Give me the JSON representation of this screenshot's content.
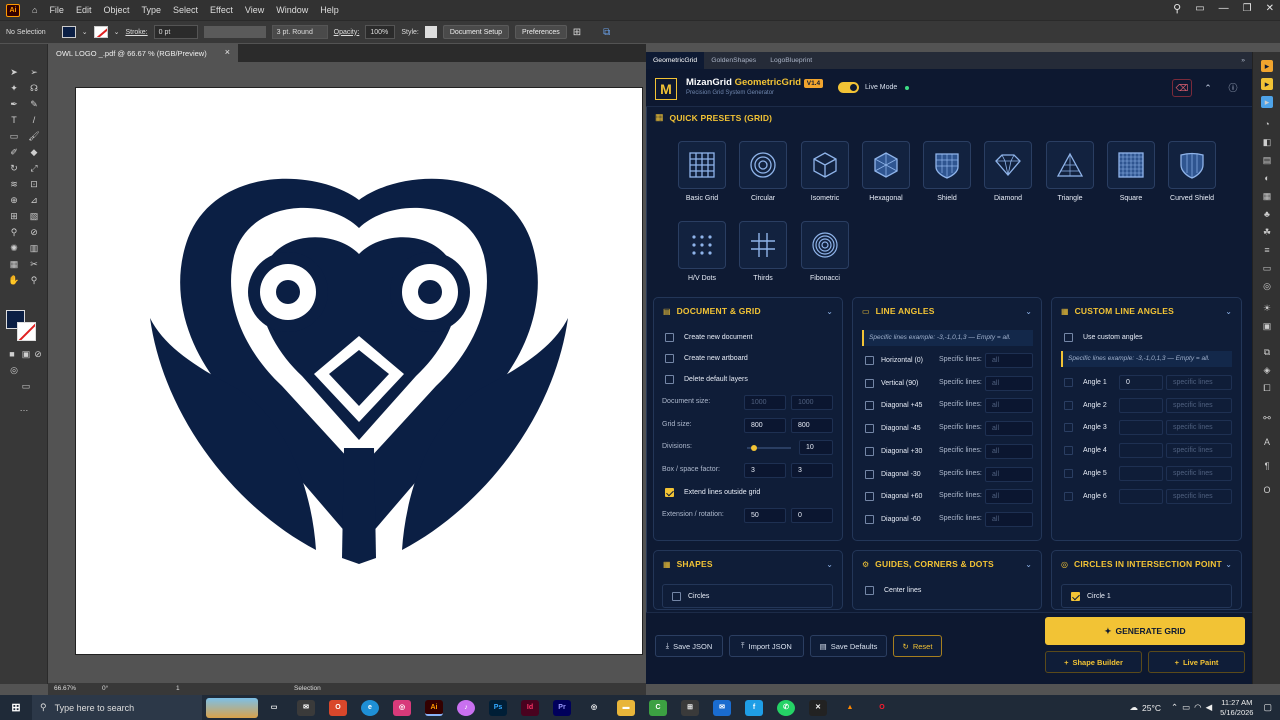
{
  "menubar": {
    "app_badge": "Ai",
    "items": [
      "File",
      "Edit",
      "Object",
      "Type",
      "Select",
      "Effect",
      "View",
      "Window",
      "Help"
    ]
  },
  "control_bar": {
    "selection_label": "No Selection",
    "stroke_label": "Stroke:",
    "stroke_value": "0 pt",
    "brush_value": "3 pt. Round",
    "opacity_label": "Opacity:",
    "opacity_value": "100%",
    "style_label": "Style:",
    "document_setup": "Document Setup",
    "preferences": "Preferences"
  },
  "document_tab": {
    "title": "OWL LOGO _.pdf @ 66.67 % (RGB/Preview)",
    "close": "×"
  },
  "status_bar": {
    "zoom": "66.67%",
    "rotation": "0°",
    "artboard": "1",
    "tool": "Selection"
  },
  "panel_tabs": [
    "GeometricGrid",
    "GoldenShapes",
    "LogoBlueprint"
  ],
  "panel_header": {
    "brand_a": "MizanGrid",
    "brand_b": "GeometricGrid",
    "version": "V1.4",
    "subtitle": "Precision Grid System Generator",
    "live_mode": "Live Mode"
  },
  "presets": {
    "title": "QUICK PRESETS (GRID)",
    "items": [
      {
        "label": "Basic Grid",
        "icon": "basic-grid-icon"
      },
      {
        "label": "Circular",
        "icon": "circular-icon"
      },
      {
        "label": "Isometric",
        "icon": "isometric-icon"
      },
      {
        "label": "Hexagonal",
        "icon": "hexagonal-icon"
      },
      {
        "label": "Shield",
        "icon": "shield-icon"
      },
      {
        "label": "Diamond",
        "icon": "diamond-icon"
      },
      {
        "label": "Triangle",
        "icon": "triangle-icon"
      },
      {
        "label": "Square",
        "icon": "square-icon"
      },
      {
        "label": "Curved Shield",
        "icon": "curved-shield-icon"
      },
      {
        "label": "H/V Dots",
        "icon": "dots-icon"
      },
      {
        "label": "Thirds",
        "icon": "thirds-icon"
      },
      {
        "label": "Fibonacci",
        "icon": "fibonacci-icon"
      }
    ]
  },
  "document_grid": {
    "title": "DOCUMENT & GRID",
    "create_doc": "Create new document",
    "create_artboard": "Create new artboard",
    "delete_layers": "Delete default layers",
    "doc_size_label": "Document size:",
    "doc_w": "1000",
    "doc_h": "1000",
    "grid_size_label": "Grid size:",
    "grid_w": "800",
    "grid_h": "800",
    "divisions_label": "Divisions:",
    "divisions": "10",
    "box_label": "Box / space factor:",
    "box_a": "3",
    "box_b": "3",
    "extend_label": "Extend lines outside grid",
    "ext_label": "Extension / rotation:",
    "ext_a": "50",
    "ext_b": "0"
  },
  "line_angles": {
    "title": "LINE ANGLES",
    "hint": "Specific lines example: -3,-1,0,1,3 — Empty = all.",
    "specific": "Specific lines:",
    "placeholder": "all",
    "rows": [
      "Horizontal (0)",
      "Vertical (90)",
      "Diagonal +45",
      "Diagonal -45",
      "Diagonal +30",
      "Diagonal -30",
      "Diagonal +60",
      "Diagonal -60"
    ]
  },
  "custom_angles": {
    "title": "CUSTOM LINE ANGLES",
    "use_custom": "Use custom angles",
    "hint": "Specific lines example: -3,-1,0,1,3 — Empty = all.",
    "placeholder": "specific lines",
    "rows": [
      {
        "label": "Angle 1",
        "value": "0"
      },
      {
        "label": "Angle 2",
        "value": ""
      },
      {
        "label": "Angle 3",
        "value": ""
      },
      {
        "label": "Angle 4",
        "value": ""
      },
      {
        "label": "Angle 5",
        "value": ""
      },
      {
        "label": "Angle 6",
        "value": ""
      }
    ]
  },
  "shapes": {
    "title": "SHAPES",
    "circles": "Circles"
  },
  "guides": {
    "title": "GUIDES, CORNERS & DOTS",
    "center_lines": "Center lines"
  },
  "circles_int": {
    "title": "CIRCLES IN INTERSECTION POINT",
    "circle1": "Circle 1"
  },
  "footer": {
    "save_json": "Save JSON",
    "import_json": "Import JSON",
    "save_defaults": "Save Defaults",
    "reset": "Reset",
    "generate": "GENERATE GRID",
    "shape_builder": "Shape Builder",
    "live_paint": "Live Paint"
  },
  "taskbar": {
    "search_placeholder": "Type here to search",
    "weather": "25°C",
    "time": "11:27 AM",
    "date": "5/16/2026"
  },
  "colors": {
    "logo": "#0b1f44",
    "accent": "#f2c335",
    "panel_bg": "#0e1a33"
  }
}
